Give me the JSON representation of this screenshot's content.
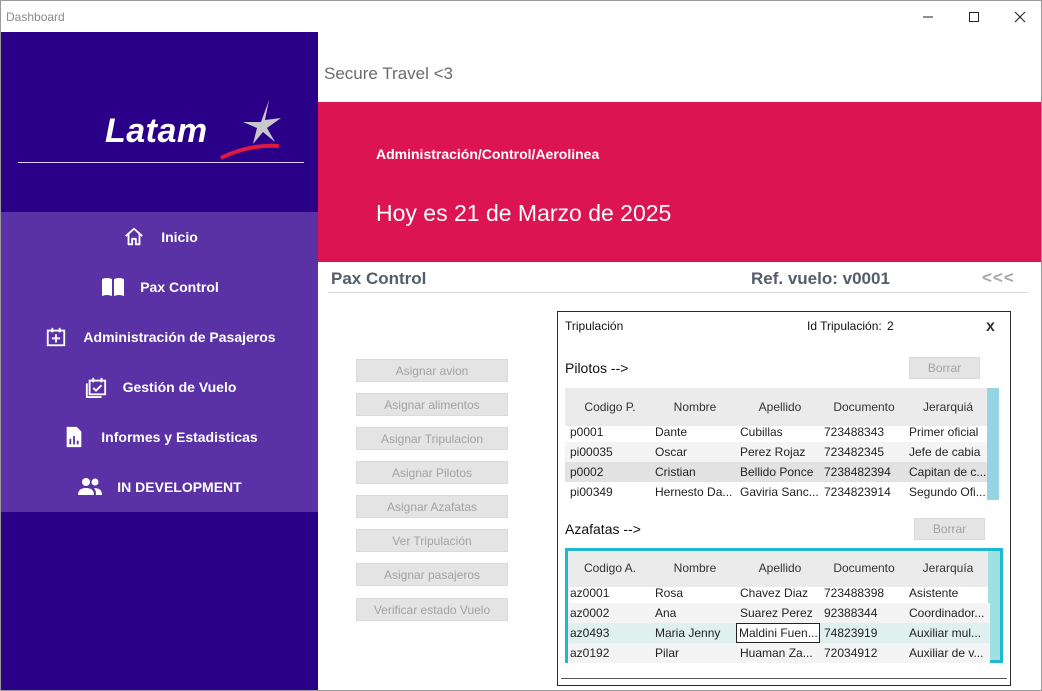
{
  "window": {
    "title": "Dashboard",
    "controls": [
      "minimize-icon",
      "maximize-icon",
      "close-icon"
    ]
  },
  "sidebar": {
    "logo": "Latam",
    "items": [
      {
        "label": "Inicio",
        "icon": "home-icon"
      },
      {
        "label": "Pax Control",
        "icon": "book-icon"
      },
      {
        "label": "Administración de Pasajeros",
        "icon": "calendar-plus-icon"
      },
      {
        "label": "Gestión de Vuelo",
        "icon": "calendar-check-icon"
      },
      {
        "label": "Informes y Estadisticas",
        "icon": "report-icon"
      },
      {
        "label": "IN DEVELOPMENT",
        "icon": "users-icon"
      }
    ]
  },
  "header": {
    "app_title": "Secure Travel <3",
    "path": "Administración/Control/Aerolinea",
    "date": "Hoy es 21 de Marzo de 2025"
  },
  "section": {
    "title": "Pax Control",
    "ref": "Ref. vuelo: v0001",
    "back": "<<<"
  },
  "actions": [
    "Asignar avion",
    "Asignar alimentos",
    "Asignar Tripulacion",
    "Asignar Pilotos",
    "Asignar Azafatas",
    "Ver Tripulación",
    "Asignar pasajeros",
    "Verificar estado Vuelo"
  ],
  "crew": {
    "title": "Tripulación",
    "id_label": "Id Tripulación:",
    "id_value": "2",
    "close": "x",
    "pilots_label": "Pilotos  -->",
    "attendants_label": "Azafatas  -->",
    "delete_label": "Borrar",
    "pilots": {
      "columns": [
        "Codigo P.",
        "Nombre",
        "Apellido",
        "Documento",
        "Jerarquiá"
      ],
      "rows": [
        [
          "p0001",
          "Dante",
          "Cubillas",
          "723488343",
          "Primer oficial"
        ],
        [
          "pi00035",
          "Oscar",
          "Perez Rojaz",
          "723482345",
          "Jefe de cabia"
        ],
        [
          "p0002",
          "Cristian",
          "Bellido Ponce",
          "7238482394",
          "Capitan de c..."
        ],
        [
          "pi00349",
          "Hernesto Da...",
          "Gaviria Sanc...",
          "7234823914",
          "Segundo Ofi..."
        ]
      ]
    },
    "attendants": {
      "columns": [
        "Codigo A.",
        "Nombre",
        "Apellido",
        "Documento",
        "Jerarquía"
      ],
      "rows": [
        [
          "az0001",
          "Rosa",
          "Chavez Diaz",
          "723488398",
          "Asistente"
        ],
        [
          "az0002",
          "Ana",
          "Suarez Perez",
          "92388344",
          "Coordinador..."
        ],
        [
          "az0493",
          "Maria Jenny",
          "Maldini Fuen...",
          "74823919",
          "Auxiliar mul..."
        ],
        [
          "az0192",
          "Pilar",
          "Huaman Za...",
          "72034912",
          "Auxiliar de v..."
        ]
      ]
    }
  },
  "colors": {
    "sidebar": "#2a0088",
    "menu": "#5a32a6",
    "banner": "#dc1552",
    "table_focus": "#1fb8cf"
  }
}
